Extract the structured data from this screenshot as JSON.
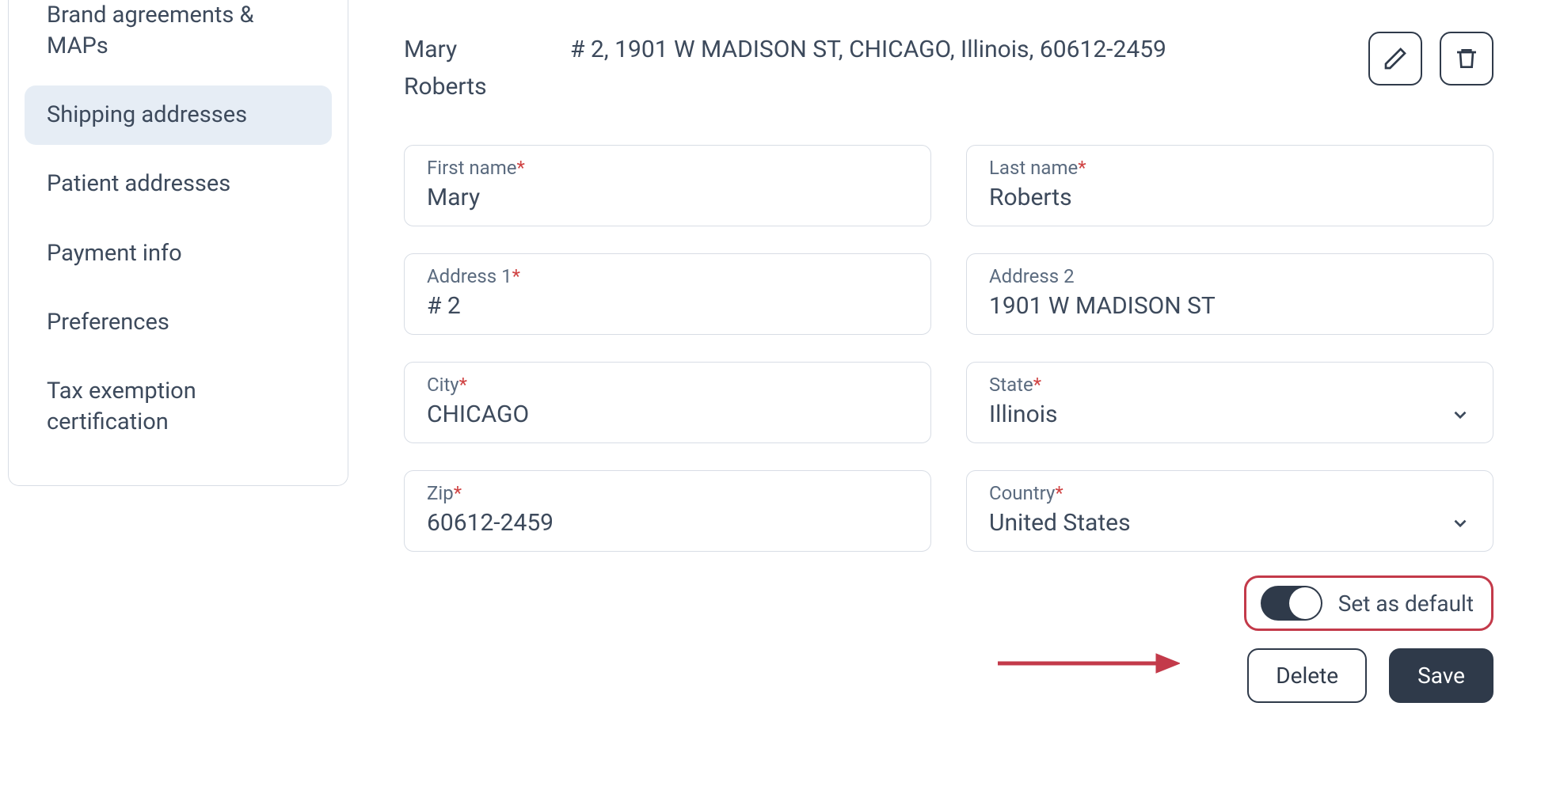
{
  "sidebar": {
    "items": [
      {
        "label": "Brand agreements & MAPs",
        "active": false
      },
      {
        "label": "Shipping addresses",
        "active": true
      },
      {
        "label": "Patient addresses",
        "active": false
      },
      {
        "label": "Payment info",
        "active": false
      },
      {
        "label": "Preferences",
        "active": false
      },
      {
        "label": "Tax exemption certification",
        "active": false
      }
    ]
  },
  "summary": {
    "name": "Mary Roberts",
    "address_line": "# 2, 1901 W MADISON ST, CHICAGO, Illinois, 60612-2459"
  },
  "form": {
    "first_name": {
      "label": "First name",
      "required": true,
      "value": "Mary"
    },
    "last_name": {
      "label": "Last name",
      "required": true,
      "value": "Roberts"
    },
    "address1": {
      "label": "Address 1",
      "required": true,
      "value": "# 2"
    },
    "address2": {
      "label": "Address 2",
      "required": false,
      "value": "1901 W MADISON ST"
    },
    "city": {
      "label": "City",
      "required": true,
      "value": "CHICAGO"
    },
    "state": {
      "label": "State",
      "required": true,
      "value": "Illinois"
    },
    "zip": {
      "label": "Zip",
      "required": true,
      "value": "60612-2459"
    },
    "country": {
      "label": "Country",
      "required": true,
      "value": "United States"
    }
  },
  "toggle": {
    "label": "Set as default",
    "on": true
  },
  "actions": {
    "delete": "Delete",
    "save": "Save"
  },
  "annotation": {
    "arrow_color": "#c33a4a"
  }
}
